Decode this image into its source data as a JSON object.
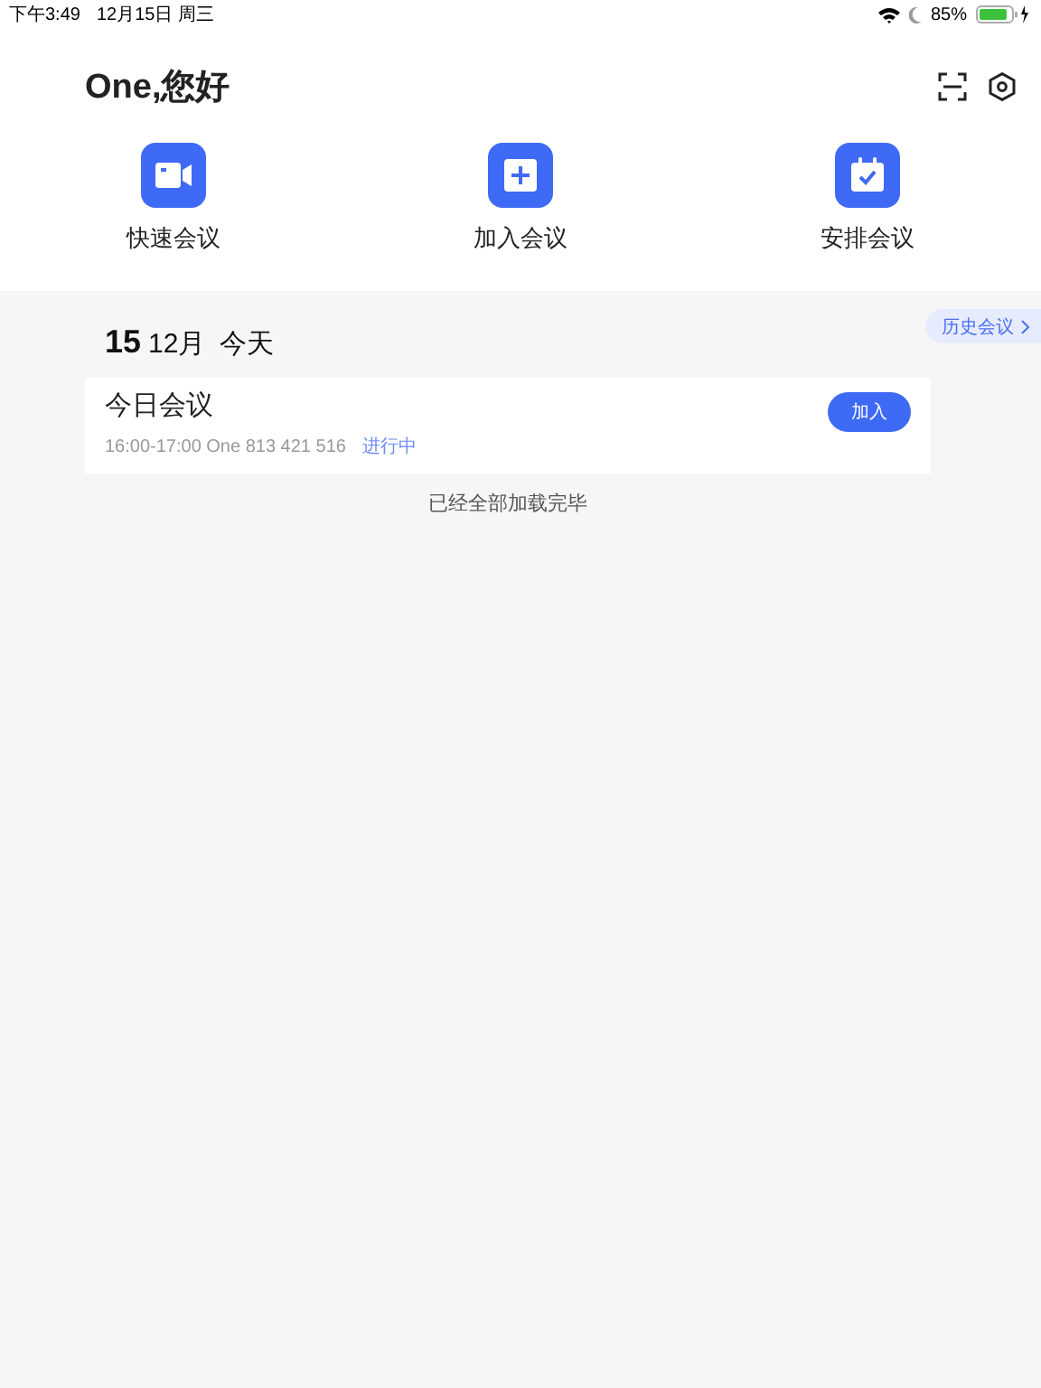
{
  "status_bar": {
    "time": "下午3:49",
    "date": "12月15日 周三",
    "battery_percent": "85%"
  },
  "header": {
    "greeting": "One,您好"
  },
  "actions": [
    {
      "kind": "video",
      "label": "快速会议"
    },
    {
      "kind": "join",
      "label": "加入会议"
    },
    {
      "kind": "schedule",
      "label": "安排会议"
    }
  ],
  "history_button": "历史会议",
  "day": {
    "day": "15",
    "month": "12月",
    "relative": "今天"
  },
  "meetings": [
    {
      "title": "今日会议",
      "details": "16:00-17:00 One 813 421 516",
      "status": "进行中",
      "button": "加入"
    }
  ],
  "footer": "已经全部加载完毕"
}
